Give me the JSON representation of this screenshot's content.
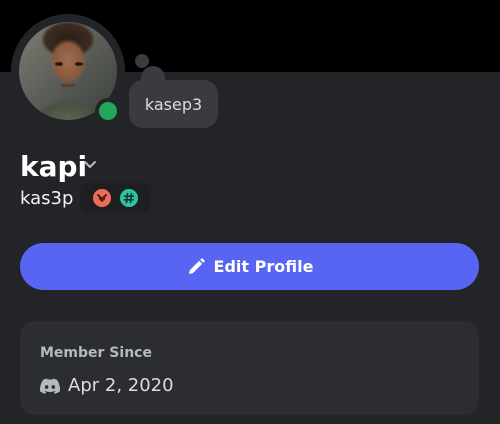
{
  "profile": {
    "display_name": "kapi",
    "username": "kas3p",
    "status_text": "kasep3",
    "presence": "online",
    "badges": [
      {
        "icon": "chevron-badge-icon",
        "color": "#ed6d5d"
      },
      {
        "icon": "hashtag-badge-icon",
        "color": "#2ec4a0"
      }
    ]
  },
  "actions": {
    "edit_profile_label": "Edit Profile"
  },
  "member_since": {
    "title": "Member Since",
    "date": "Apr 2, 2020",
    "icon": "discord-icon"
  },
  "colors": {
    "accent": "#5865f2",
    "online": "#23a55a",
    "background": "#232428",
    "card": "#2b2d31"
  }
}
